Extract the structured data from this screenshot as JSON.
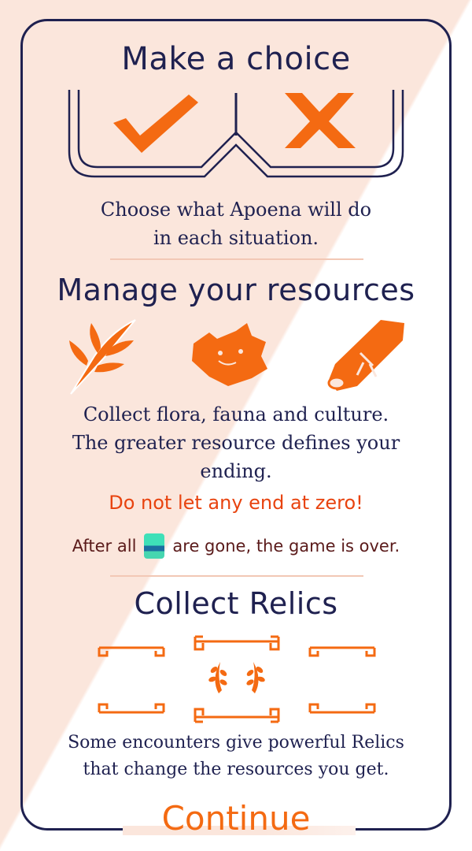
{
  "sections": {
    "choice": {
      "title": "Make a choice",
      "description_lines": [
        "Choose what Apoena will do",
        "in each situation."
      ]
    },
    "resources": {
      "title": "Manage your resources",
      "icons": [
        "flora-icon",
        "fauna-icon",
        "culture-icon"
      ],
      "description_lines": [
        "Collect flora, fauna and culture.",
        "The greater resource defines your",
        "ending."
      ],
      "warning": "Do not let any end at zero!",
      "after_prefix": "After all",
      "after_suffix": "are gone, the game is over."
    },
    "relics": {
      "title": "Collect Relics",
      "description_lines": [
        "Some encounters give powerful Relics",
        "that change the resources you get."
      ]
    }
  },
  "continue_label": "Continue",
  "colors": {
    "navy": "#1f2150",
    "orange": "#f46a12",
    "warning_red": "#e8430f",
    "peach": "#fbe6dc"
  }
}
